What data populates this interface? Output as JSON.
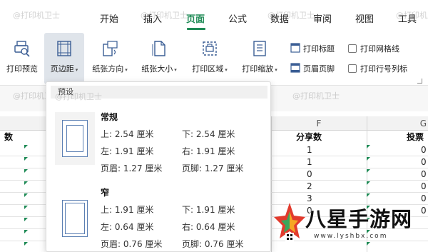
{
  "menu": {
    "tabs": [
      "开始",
      "插入",
      "页面",
      "公式",
      "数据",
      "审阅",
      "视图",
      "工具"
    ],
    "active_index": 2
  },
  "ribbon": {
    "print_preview": "打印预览",
    "margins": "页边距",
    "orientation": "纸张方向",
    "paper_size": "纸张大小",
    "print_area": "打印区域",
    "print_scaling": "打印缩放",
    "print_titles": "打印标题",
    "header_footer": "页眉页脚",
    "print_gridlines": "打印网格线",
    "print_row_col_headers": "打印行号列标"
  },
  "watermark": "@打印机卫士",
  "sheet": {
    "col_F": "F",
    "col_G": "G",
    "header_left": "数",
    "header_F": "分享数",
    "header_G": "投票",
    "F_values": [
      "1",
      "1",
      "0",
      "2",
      "3",
      "0"
    ],
    "G_values": [
      "0",
      "0",
      "0",
      "0",
      "0",
      "0"
    ]
  },
  "dropdown": {
    "section_title": "预设",
    "presets": [
      {
        "name": "常规",
        "top": "上: 2.54 厘米",
        "bottom": "下: 2.54 厘米",
        "left": "左: 1.91 厘米",
        "right": "右: 1.91 厘米",
        "header": "页眉: 1.27 厘米",
        "footer": "页脚: 1.27 厘米"
      },
      {
        "name": "窄",
        "top": "上: 1.91 厘米",
        "bottom": "下: 1.91 厘米",
        "left": "左: 0.64 厘米",
        "right": "右: 0.64 厘米",
        "header": "页眉: 0.76 厘米",
        "footer": "页脚: 0.76 厘米"
      }
    ]
  },
  "brand": {
    "name": "八星手游网",
    "url": "www.lyshbx.com"
  },
  "colors": {
    "accent_green": "#1e8a55",
    "icon_blue": "#3a5d94",
    "logo_red": "#e23b2e"
  }
}
